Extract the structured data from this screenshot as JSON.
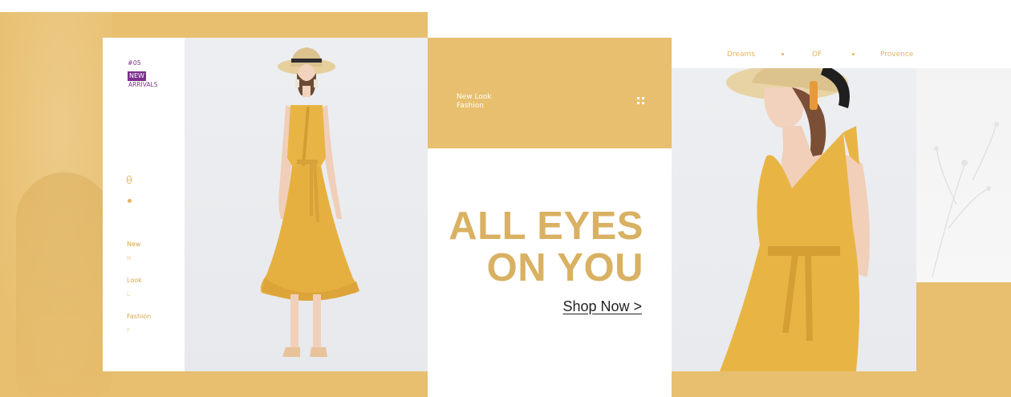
{
  "sidebar": {
    "number": "#05",
    "new_badge": "NEW",
    "arrivals": "ARRIVALS",
    "items": [
      {
        "label": "New",
        "sub": "N"
      },
      {
        "label": "Look",
        "sub": "L"
      },
      {
        "label": "Fashion",
        "sub": "F"
      }
    ]
  },
  "center": {
    "label_line1": "New Look",
    "label_line2": "Fashion",
    "headline_line1": "ALL EYES",
    "headline_line2": "ON YOU",
    "cta": "Shop Now >"
  },
  "right_nav": {
    "words": [
      "Dreams",
      "OF",
      "Provence"
    ]
  },
  "colors": {
    "mustard": "#e8bf6f",
    "headline": "#d9b162",
    "badge_purple": "#7b2f8e",
    "dress": "#e8b545"
  },
  "icons": {
    "ring": "ring-icon",
    "dot": "dot-icon",
    "grid": "grid-dots-icon"
  }
}
